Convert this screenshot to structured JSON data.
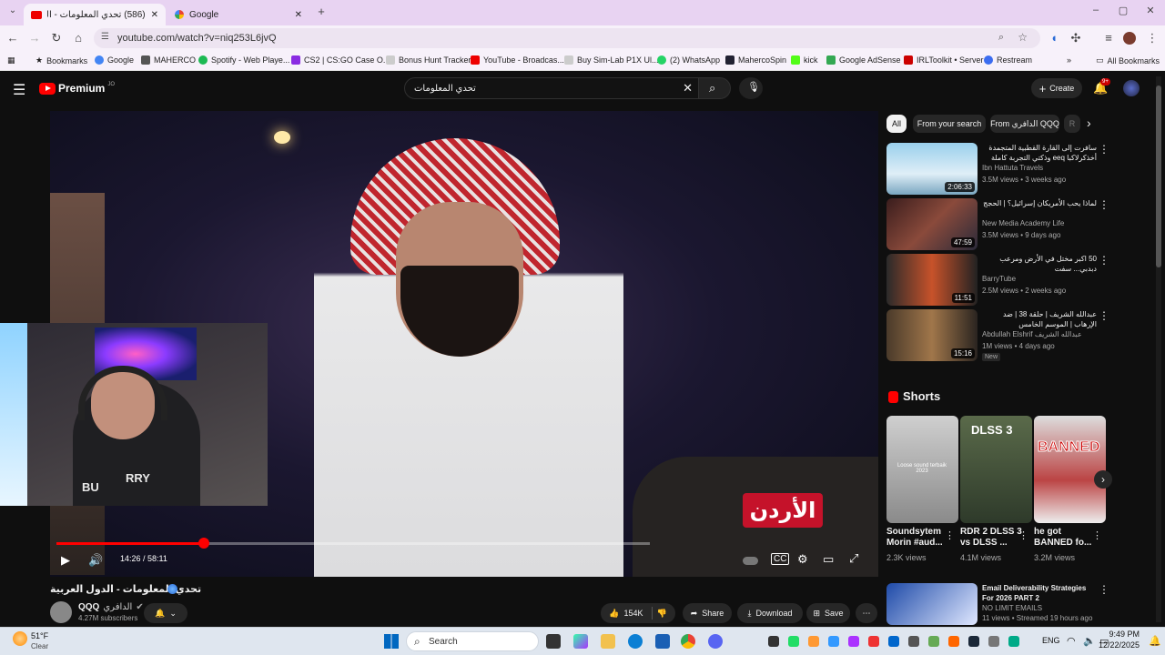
{
  "browser": {
    "tabs": [
      {
        "label": "(586) تحدي المعلومات - الدول ال",
        "active": true
      },
      {
        "label": "Google",
        "active": false
      }
    ],
    "url": "youtube.com/watch?v=niq253L6jvQ",
    "bookmarks": [
      "Bookmarks",
      "Google",
      "MAHERCO",
      "Spotify - Web Playe...",
      "CS2 | CS:GO Case O...",
      "Bonus Hunt Tracker",
      "YouTube - Broadcas...",
      "Buy Sim-Lab P1X Ul...",
      "(2) WhatsApp",
      "MahercoSpin",
      "kick",
      "Google AdSense",
      "IRLToolkit • Server",
      "Restream"
    ],
    "all_bookmarks": "All Bookmarks"
  },
  "youtube": {
    "logo_text": "Premium",
    "logo_sup": "JO",
    "search_value": "تحدي المعلومات",
    "create_label": "Create",
    "notif_count": "9+",
    "player": {
      "time": "14:26 / 58:11",
      "progress_fraction": 0.248,
      "overlay_text": "الأردن",
      "webcam_shirt_left": "BU",
      "webcam_shirt_right": "RRY"
    },
    "video": {
      "title": "تحدي المعلومات - الدول العربية",
      "channel": "QQQ",
      "channel_arabic": "الدافري",
      "subscribers": "4.27M subscribers",
      "likes": "154K",
      "share_label": "Share",
      "download_label": "Download",
      "save_label": "Save"
    },
    "chips": [
      "All",
      "From your search",
      "From الدافري QQQ",
      "R"
    ],
    "recommendations": [
      {
        "title": "سافرت إلى القارة القطبية المتجمدة أخذكرلاكبا eeq وذكتي التجربة كاملة",
        "channel": "Ibn Hattuta Travels",
        "meta": "3.5M views • 3 weeks ago",
        "duration": "2:06:33",
        "new": ""
      },
      {
        "title": "لماذا يحب الأمريكان إسرائيل؟ | الحجج",
        "channel": "New Media Academy Life",
        "meta": "3.5M views • 9 days ago",
        "duration": "47:59",
        "new": ""
      },
      {
        "title": "50 اكبر مختل في الأرض ومرعب دبدبي... سفت",
        "channel": "BarryTube",
        "meta": "2.5M views • 2 weeks ago",
        "duration": "11:51",
        "new": ""
      },
      {
        "title": "عبدالله الشريف | حلقة 38 | ضد الإرهاب | الموسم الخامس",
        "channel": "Abdullah Elshrif عبدالله الشريف",
        "meta": "1M views • 4 days ago",
        "duration": "15:16",
        "new": "New"
      }
    ],
    "shorts_label": "Shorts",
    "shorts": [
      {
        "title": "Soundsytem Morin #aud...",
        "views": "2.3K views",
        "thumb_text": "Loose sound terbaik 2023"
      },
      {
        "title": "RDR 2 DLSS 3 vs DLSS ...",
        "views": "4.1M views",
        "thumb_text": "DLSS 3"
      },
      {
        "title": "he got BANNED fo...",
        "views": "3.2M views",
        "thumb_text": "BANNED"
      }
    ],
    "bottom_rec": {
      "title": "Email Deliverability Strategies For 2026 PART 2",
      "channel": "NO LIMIT EMAILS",
      "meta": "11 views • Streamed 19 hours ago"
    }
  },
  "taskbar": {
    "weather_temp": "51°F",
    "weather_desc": "Clear",
    "search_label": "Search",
    "lang": "ENG",
    "time": "9:49 PM",
    "date": "12/22/2025"
  }
}
